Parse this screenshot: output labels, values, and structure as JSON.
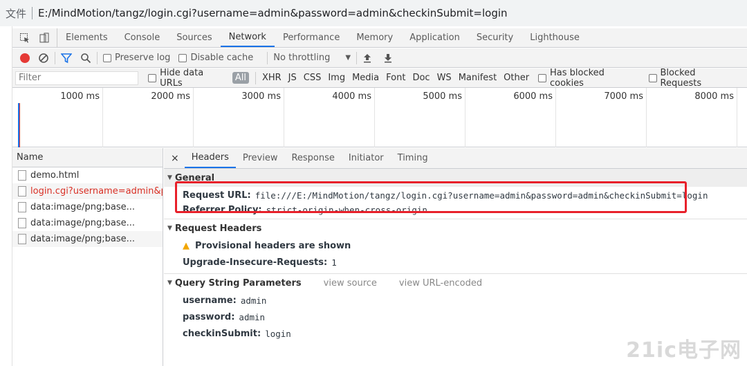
{
  "address_bar": {
    "prefix": "文件",
    "url": "E:/MindMotion/tangz/login.cgi?username=admin&password=admin&checkinSubmit=login"
  },
  "main_tabs": [
    "Elements",
    "Console",
    "Sources",
    "Network",
    "Performance",
    "Memory",
    "Application",
    "Security",
    "Lighthouse"
  ],
  "active_main_tab": "Network",
  "toolbar": {
    "preserve_log": "Preserve log",
    "disable_cache": "Disable cache",
    "throttling": "No throttling"
  },
  "filter": {
    "placeholder": "Filter",
    "hide_data_urls": "Hide data URLs",
    "types": [
      "All",
      "XHR",
      "JS",
      "CSS",
      "Img",
      "Media",
      "Font",
      "Doc",
      "WS",
      "Manifest",
      "Other"
    ],
    "has_blocked_cookies": "Has blocked cookies",
    "blocked_requests": "Blocked Requests"
  },
  "timeline": {
    "ticks": [
      "1000 ms",
      "2000 ms",
      "3000 ms",
      "4000 ms",
      "5000 ms",
      "6000 ms",
      "7000 ms",
      "8000 ms"
    ]
  },
  "request_list": {
    "header": "Name",
    "items": [
      "demo.html",
      "login.cgi?username=admin&p...",
      "data:image/png;base...",
      "data:image/png;base...",
      "data:image/png;base..."
    ]
  },
  "details": {
    "close": "×",
    "tabs": [
      "Headers",
      "Preview",
      "Response",
      "Initiator",
      "Timing"
    ],
    "general": {
      "title": "General",
      "request_url_key": "Request URL:",
      "request_url_val": "file:///E:/MindMotion/tangz/login.cgi?username=admin&password=admin&checkinSubmit=login",
      "referrer_key": "Referrer Policy:",
      "referrer_val": "strict-origin-when-cross-origin"
    },
    "request_headers": {
      "title": "Request Headers",
      "warning": "Provisional headers are shown",
      "uir_key": "Upgrade-Insecure-Requests:",
      "uir_val": "1"
    },
    "query": {
      "title": "Query String Parameters",
      "view_source": "view source",
      "view_url_encoded": "view URL-encoded",
      "params": [
        {
          "key": "username:",
          "val": "admin"
        },
        {
          "key": "password:",
          "val": "admin"
        },
        {
          "key": "checkinSubmit:",
          "val": "login"
        }
      ]
    }
  },
  "watermark": "21ic电子网"
}
